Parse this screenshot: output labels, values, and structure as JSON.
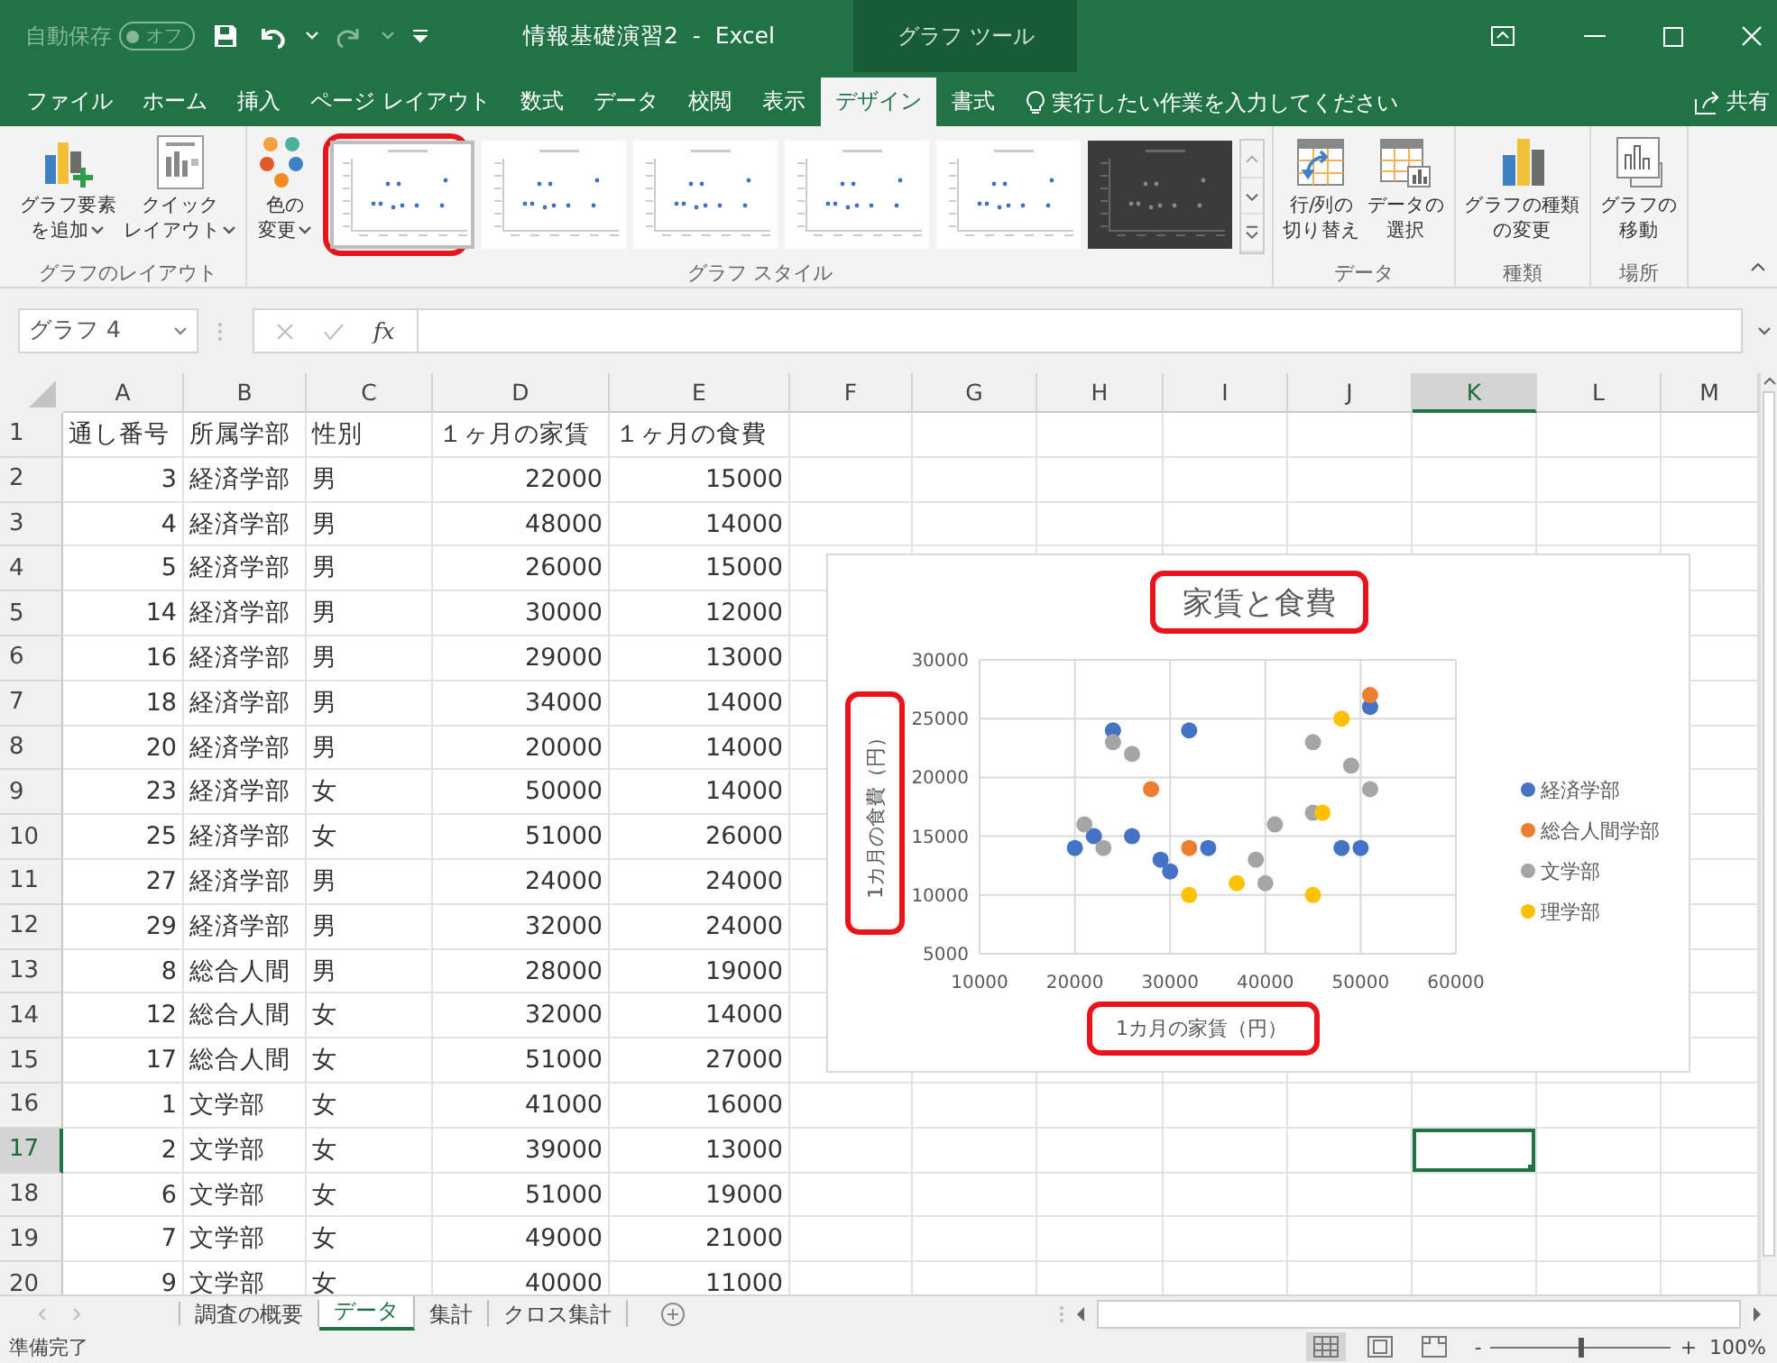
{
  "title_bar": {
    "autosave_label": "自動保存",
    "autosave_toggle": "オフ",
    "autosave_on": false,
    "title": "情報基礎演習2  -  Excel",
    "context_tab": "グラフ ツール"
  },
  "ribbon_tabs": [
    {
      "label": "ファイル",
      "selected": false
    },
    {
      "label": "ホーム",
      "selected": false
    },
    {
      "label": "挿入",
      "selected": false
    },
    {
      "label": "ページ レイアウト",
      "selected": false
    },
    {
      "label": "数式",
      "selected": false
    },
    {
      "label": "データ",
      "selected": false
    },
    {
      "label": "校閲",
      "selected": false
    },
    {
      "label": "表示",
      "selected": false
    },
    {
      "label": "デザイン",
      "selected": true
    },
    {
      "label": "書式",
      "selected": false
    }
  ],
  "tell_me": {
    "placeholder": "実行したい作業を入力してください"
  },
  "share": {
    "label": "共有"
  },
  "ribbon_groups": [
    {
      "label": "グラフのレイアウト",
      "items": [
        {
          "kind": "button",
          "lines": [
            "グラフ要素",
            "を追加"
          ],
          "dropdown": true
        },
        {
          "kind": "button",
          "lines": [
            "クイック",
            "レイアウト"
          ],
          "dropdown": true
        }
      ]
    },
    {
      "label": "グラフ スタイル",
      "items": [
        {
          "kind": "button",
          "lines": [
            "色の",
            "変更"
          ],
          "dropdown": true
        },
        {
          "kind": "gallery",
          "styles": [
            {
              "dark": false,
              "selected": true,
              "highlighted": true
            },
            {
              "dark": false,
              "selected": false,
              "highlighted": false
            },
            {
              "dark": false,
              "selected": false,
              "highlighted": false
            },
            {
              "dark": false,
              "selected": false,
              "highlighted": false
            },
            {
              "dark": false,
              "selected": false,
              "highlighted": false
            },
            {
              "dark": true,
              "selected": false,
              "highlighted": false
            }
          ]
        }
      ]
    },
    {
      "label": "データ",
      "items": [
        {
          "kind": "button",
          "lines": [
            "行/列の",
            "切り替え"
          ],
          "dropdown": false
        },
        {
          "kind": "button",
          "lines": [
            "データの",
            "選択"
          ],
          "dropdown": false
        }
      ]
    },
    {
      "label": "種類",
      "items": [
        {
          "kind": "button",
          "lines": [
            "グラフの種類",
            "の変更"
          ],
          "dropdown": false
        }
      ]
    },
    {
      "label": "場所",
      "items": [
        {
          "kind": "button",
          "lines": [
            "グラフの",
            "移動"
          ],
          "dropdown": false
        }
      ]
    }
  ],
  "formula_bar": {
    "name_box": "グラフ 4",
    "function_label": "fx"
  },
  "sheet": {
    "columns": [
      {
        "label": "A",
        "selected": false
      },
      {
        "label": "B",
        "selected": false
      },
      {
        "label": "C",
        "selected": false
      },
      {
        "label": "D",
        "selected": false
      },
      {
        "label": "E",
        "selected": false
      },
      {
        "label": "F",
        "selected": false
      },
      {
        "label": "G",
        "selected": false
      },
      {
        "label": "H",
        "selected": false
      },
      {
        "label": "I",
        "selected": false
      },
      {
        "label": "J",
        "selected": false
      },
      {
        "label": "K",
        "selected": true
      },
      {
        "label": "L",
        "selected": false
      },
      {
        "label": "M",
        "selected": false
      }
    ],
    "rows": [
      {
        "number": "1",
        "kind": "header",
        "selected": false,
        "cells": [
          "通し番号",
          "所属学部",
          "性別",
          "１ヶ月の家賃",
          "１ヶ月の食費"
        ]
      },
      {
        "number": "2",
        "kind": "data",
        "selected": false,
        "cells": [
          "3",
          "経済学部",
          "男",
          "22000",
          "15000"
        ]
      },
      {
        "number": "3",
        "kind": "data",
        "selected": false,
        "cells": [
          "4",
          "経済学部",
          "男",
          "48000",
          "14000"
        ]
      },
      {
        "number": "4",
        "kind": "data",
        "selected": false,
        "cells": [
          "5",
          "経済学部",
          "男",
          "26000",
          "15000"
        ]
      },
      {
        "number": "5",
        "kind": "data",
        "selected": false,
        "cells": [
          "14",
          "経済学部",
          "男",
          "30000",
          "12000"
        ]
      },
      {
        "number": "6",
        "kind": "data",
        "selected": false,
        "cells": [
          "16",
          "経済学部",
          "男",
          "29000",
          "13000"
        ]
      },
      {
        "number": "7",
        "kind": "data",
        "selected": false,
        "cells": [
          "18",
          "経済学部",
          "男",
          "34000",
          "14000"
        ]
      },
      {
        "number": "8",
        "kind": "data",
        "selected": false,
        "cells": [
          "20",
          "経済学部",
          "男",
          "20000",
          "14000"
        ]
      },
      {
        "number": "9",
        "kind": "data",
        "selected": false,
        "cells": [
          "23",
          "経済学部",
          "女",
          "50000",
          "14000"
        ]
      },
      {
        "number": "10",
        "kind": "data",
        "selected": false,
        "cells": [
          "25",
          "経済学部",
          "女",
          "51000",
          "26000"
        ]
      },
      {
        "number": "11",
        "kind": "data",
        "selected": false,
        "cells": [
          "27",
          "経済学部",
          "男",
          "24000",
          "24000"
        ]
      },
      {
        "number": "12",
        "kind": "data",
        "selected": false,
        "cells": [
          "29",
          "経済学部",
          "男",
          "32000",
          "24000"
        ]
      },
      {
        "number": "13",
        "kind": "data",
        "selected": false,
        "cells": [
          "8",
          "総合人間",
          "男",
          "28000",
          "19000"
        ]
      },
      {
        "number": "14",
        "kind": "data",
        "selected": false,
        "cells": [
          "12",
          "総合人間",
          "女",
          "32000",
          "14000"
        ]
      },
      {
        "number": "15",
        "kind": "data",
        "selected": false,
        "cells": [
          "17",
          "総合人間",
          "女",
          "51000",
          "27000"
        ]
      },
      {
        "number": "16",
        "kind": "data",
        "selected": false,
        "cells": [
          "1",
          "文学部",
          "女",
          "41000",
          "16000"
        ]
      },
      {
        "number": "17",
        "kind": "data",
        "selected": true,
        "cells": [
          "2",
          "文学部",
          "女",
          "39000",
          "13000"
        ]
      },
      {
        "number": "18",
        "kind": "data",
        "selected": false,
        "cells": [
          "6",
          "文学部",
          "女",
          "51000",
          "19000"
        ]
      },
      {
        "number": "19",
        "kind": "data",
        "selected": false,
        "cells": [
          "7",
          "文学部",
          "女",
          "49000",
          "21000"
        ]
      },
      {
        "number": "20",
        "kind": "data",
        "selected": false,
        "cells": [
          "9",
          "文学部",
          "女",
          "40000",
          "11000"
        ]
      }
    ],
    "chart": {
      "highlights": {
        "title": true,
        "xlabel": true,
        "ylabel": true
      },
      "chart_data": {
        "type": "scatter",
        "grid": true,
        "legend": "right",
        "title": "家賃と食費",
        "xlabel": "1カ月の家賃（円）",
        "ylabel": "1カ月の食費（円）",
        "xlim": [
          10000,
          60000
        ],
        "ylim": [
          5000,
          30000
        ],
        "xticks": [
          10000,
          20000,
          30000,
          40000,
          50000,
          60000
        ],
        "yticks": [
          5000,
          10000,
          15000,
          20000,
          25000,
          30000
        ],
        "series": [
          {
            "name": "経済学部",
            "color": "#4472c4",
            "x": [
              22000,
              48000,
              26000,
              30000,
              29000,
              34000,
              20000,
              50000,
              51000,
              24000,
              32000
            ],
            "values": [
              15000,
              14000,
              15000,
              12000,
              13000,
              14000,
              14000,
              14000,
              26000,
              24000,
              24000
            ]
          },
          {
            "name": "総合人間学部",
            "color": "#ed7d31",
            "x": [
              28000,
              32000,
              51000
            ],
            "values": [
              19000,
              14000,
              27000
            ]
          },
          {
            "name": "文学部",
            "color": "#a5a5a5",
            "x": [
              21000,
              23000,
              24000,
              26000,
              39000,
              40000,
              41000,
              45000,
              45000,
              49000,
              51000
            ],
            "values": [
              16000,
              14000,
              23000,
              22000,
              13000,
              11000,
              16000,
              17000,
              23000,
              21000,
              19000
            ]
          },
          {
            "name": "理学部",
            "color": "#ffc000",
            "x": [
              32000,
              37000,
              45000,
              46000,
              48000
            ],
            "values": [
              10000,
              11000,
              10000,
              17000,
              25000
            ]
          }
        ]
      }
    }
  },
  "sheet_tabs": [
    {
      "label": "調査の概要",
      "selected": false
    },
    {
      "label": "データ",
      "selected": true
    },
    {
      "label": "集計",
      "selected": false
    },
    {
      "label": "クロス集計",
      "selected": false
    }
  ],
  "status_bar": {
    "status": "準備完了",
    "view_modes": [
      {
        "kind": "normal",
        "selected": true
      },
      {
        "kind": "page-layout",
        "selected": false
      },
      {
        "kind": "page-break",
        "selected": false
      }
    ],
    "zoom_out": "-",
    "zoom_slider": {
      "level": 0.5
    },
    "zoom_in": "+",
    "zoom": "100%"
  }
}
